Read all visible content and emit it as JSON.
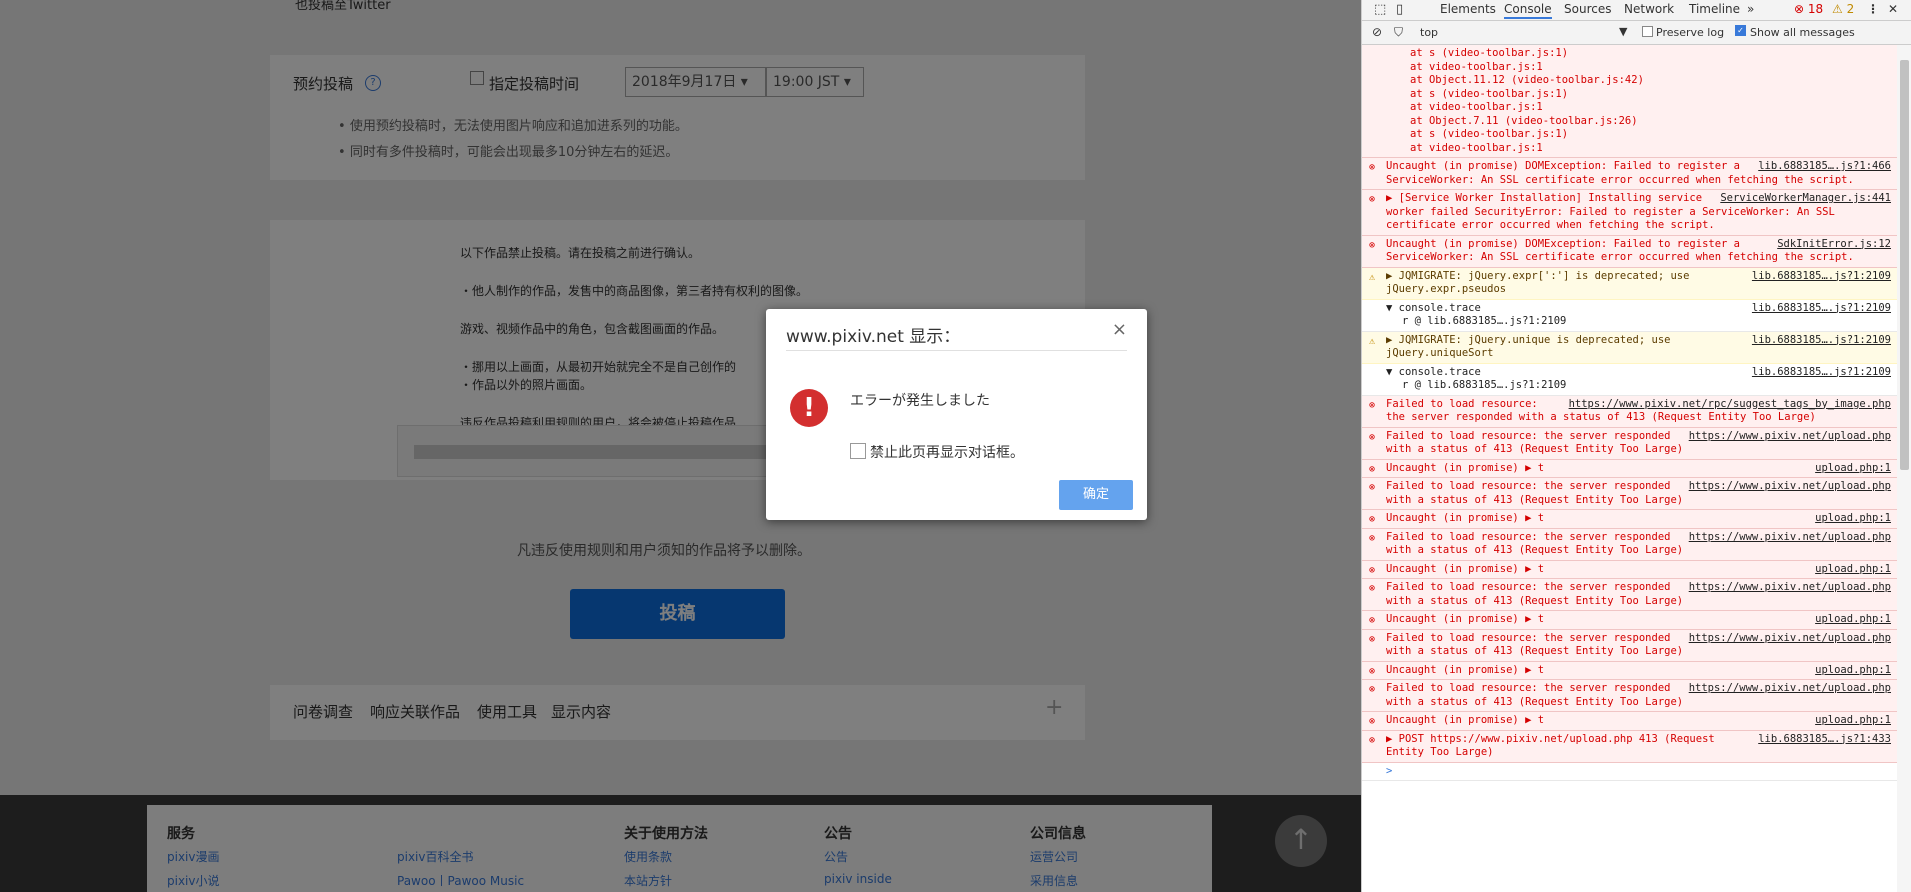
{
  "page": {
    "twitter_label": "也投稿至Twitter",
    "schedule_label": "预约投稿",
    "schedule_checkbox_label": "指定投稿时间",
    "date_value": "2018年9月17日",
    "time_value": "19:00 JST",
    "notes": [
      "使用预约投稿时，无法使用图片响应和追加进系列的功能。",
      "同时有多件投稿时，可能会出现最多10分钟左右的延迟。"
    ],
    "rules": [
      "以下作品禁止投稿。请在投稿之前进行确认。",
      "・他人制作的作品，发售中的商品图像，第三者持有权利的图像。",
      "游戏、视频作品中的角色，包含截图画面的作品。",
      "・挪用以上画面，从最初开始就完全不是自己创作的",
      "・作品以外的照片画面。",
      "违反作品投稿利用规则的用户，将会被停止投稿作品"
    ],
    "violation_text": "凡违反使用规则和用户须知的作品将予以删除。",
    "submit_label": "投稿",
    "footer_tabs": [
      "问卷调查",
      "响应关联作品",
      "使用工具",
      "显示内容"
    ],
    "footer": {
      "col1_title": "服务",
      "col1_items": [
        "pixiv漫画",
        "pixiv小说"
      ],
      "col2_items": [
        "pixiv百科全书",
        "Pawoo丨Pawoo Music"
      ],
      "col3_title": "关于使用方法",
      "col3_items": [
        "使用条款",
        "本站方针"
      ],
      "col4_title": "公告",
      "col4_items": [
        "公告",
        "pixiv inside"
      ],
      "col5_title": "公司信息",
      "col5_items": [
        "运营公司",
        "采用信息"
      ]
    }
  },
  "dialog": {
    "title": "www.pixiv.net 显示：",
    "close": "×",
    "message": "エラーが発生しました",
    "checkbox_label": "禁止此页再显示对话框。",
    "ok_label": "确定"
  },
  "devtools": {
    "tabs": [
      "Elements",
      "Console",
      "Sources",
      "Network",
      "Timeline",
      "»"
    ],
    "active_tab": "Console",
    "error_count": "18",
    "warning_count": "2",
    "context": "top",
    "preserve_log": "Preserve log",
    "show_all": "Show all messages",
    "stack": [
      "at s (video-toolbar.js:1)",
      "at video-toolbar.js:1",
      "at Object.11.12 (video-toolbar.js:42)",
      "at s (video-toolbar.js:1)",
      "at video-toolbar.js:1",
      "at Object.7.11 (video-toolbar.js:26)",
      "at s (video-toolbar.js:1)",
      "at video-toolbar.js:1"
    ],
    "messages": [
      {
        "type": "err",
        "text": "Uncaught (in promise) DOMException: Failed to register a ServiceWorker: An SSL certificate error occurred when fetching the script.",
        "src": "lib.6883185….js?1:466"
      },
      {
        "type": "err",
        "text": "▶ [Service Worker Installation] Installing service worker failed SecurityError: Failed to register a ServiceWorker: An SSL certificate error occurred when fetching the script.",
        "src": "ServiceWorkerManager.js:441"
      },
      {
        "type": "err",
        "text": "Uncaught (in promise) DOMException: Failed to register a ServiceWorker: An SSL certificate error occurred when fetching the script.",
        "src": "SdkInitError.js:12"
      },
      {
        "type": "warn",
        "text": "▶ JQMIGRATE: jQuery.expr[':'] is deprecated; use jQuery.expr.pseudos",
        "src": "lib.6883185….js?1:2109"
      },
      {
        "type": "info",
        "text": "▼ console.trace",
        "src": "lib.6883185….js?1:2109",
        "sub": "r @ lib.6883185….js?1:2109"
      },
      {
        "type": "warn",
        "text": "▶ JQMIGRATE: jQuery.unique is deprecated; use jQuery.uniqueSort",
        "src": "lib.6883185….js?1:2109"
      },
      {
        "type": "info",
        "text": "▼ console.trace",
        "src": "lib.6883185….js?1:2109",
        "sub": "r @ lib.6883185….js?1:2109"
      },
      {
        "type": "err",
        "text": "Failed to load resource: the server responded with a status of 413 (Request Entity Too Large)",
        "src": "https://www.pixiv.net/rpc/suggest_tags_by_image.php"
      },
      {
        "type": "err",
        "text": "Failed to load resource: the server responded with a status of 413 (Request Entity Too Large)",
        "src": "https://www.pixiv.net/upload.php"
      },
      {
        "type": "err",
        "text": "Uncaught (in promise) ▶ t",
        "src": "upload.php:1"
      },
      {
        "type": "err",
        "text": "Failed to load resource: the server responded with a status of 413 (Request Entity Too Large)",
        "src": "https://www.pixiv.net/upload.php"
      },
      {
        "type": "err",
        "text": "Uncaught (in promise) ▶ t",
        "src": "upload.php:1"
      },
      {
        "type": "err",
        "text": "Failed to load resource: the server responded with a status of 413 (Request Entity Too Large)",
        "src": "https://www.pixiv.net/upload.php"
      },
      {
        "type": "err",
        "text": "Uncaught (in promise) ▶ t",
        "src": "upload.php:1"
      },
      {
        "type": "err",
        "text": "Failed to load resource: the server responded with a status of 413 (Request Entity Too Large)",
        "src": "https://www.pixiv.net/upload.php"
      },
      {
        "type": "err",
        "text": "Uncaught (in promise) ▶ t",
        "src": "upload.php:1"
      },
      {
        "type": "err",
        "text": "Failed to load resource: the server responded with a status of 413 (Request Entity Too Large)",
        "src": "https://www.pixiv.net/upload.php"
      },
      {
        "type": "err",
        "text": "Uncaught (in promise) ▶ t",
        "src": "upload.php:1"
      },
      {
        "type": "err",
        "text": "Failed to load resource: the server responded with a status of 413 (Request Entity Too Large)",
        "src": "https://www.pixiv.net/upload.php"
      },
      {
        "type": "err",
        "text": "Uncaught (in promise) ▶ t",
        "src": "upload.php:1"
      },
      {
        "type": "err",
        "text": "▶ POST https://www.pixiv.net/upload.php 413 (Request Entity Too Large)",
        "src": "lib.6883185….js?1:433"
      }
    ]
  }
}
